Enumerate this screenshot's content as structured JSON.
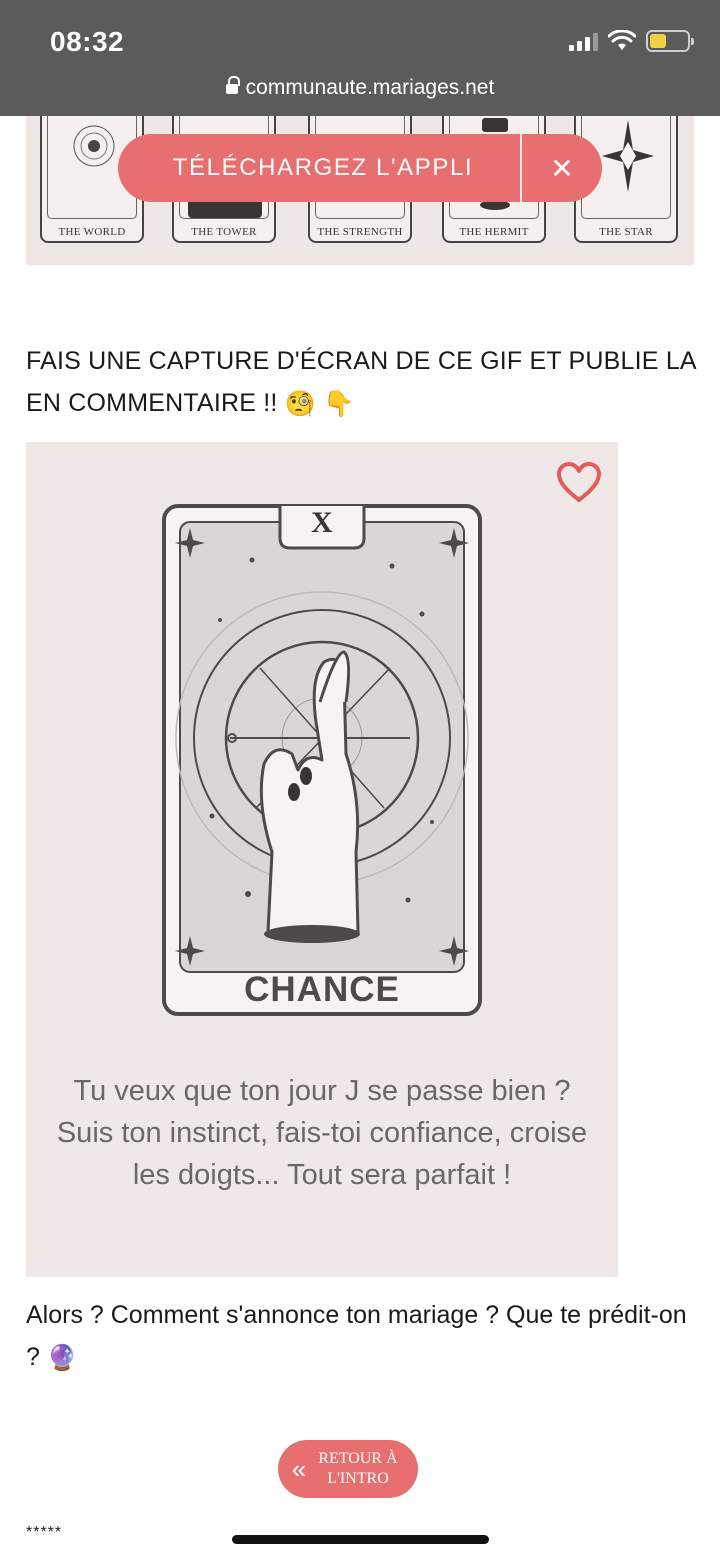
{
  "status_bar": {
    "time": "08:32"
  },
  "browser": {
    "url": "communaute.mariages.net"
  },
  "tarot_strip": {
    "cards": [
      "THE WORLD",
      "THE TOWER",
      "THE STRENGTH",
      "THE HERMIT",
      "THE STAR"
    ]
  },
  "app_banner": {
    "label": "TÉLÉCHARGEZ L'APPLI",
    "close": "✕"
  },
  "headline": "FAIS UNE CAPTURE D'ÉCRAN DE CE GIF ET PUBLIE LA EN COMMENTAIRE !!",
  "headline_emojis": [
    "🧐",
    "👇"
  ],
  "tarot_card": {
    "numeral": "X",
    "title": "CHANCE",
    "text": "Tu veux que ton jour J se passe bien ? Suis ton instinct, fais-toi confiance, croise les doigts... Tout sera parfait !"
  },
  "question": "Alors ? Comment s'annonce ton mariage ? Que te prédit-on ?",
  "question_emoji": "🔮",
  "retour_button": {
    "label": "RETOUR À\nL'INTRO",
    "icon": "double-chevron-left-icon"
  },
  "footer_text": "*****",
  "colors": {
    "accent": "#e86f6f",
    "card_bg": "#efe8e7",
    "chrome": "#5b5b5b"
  }
}
